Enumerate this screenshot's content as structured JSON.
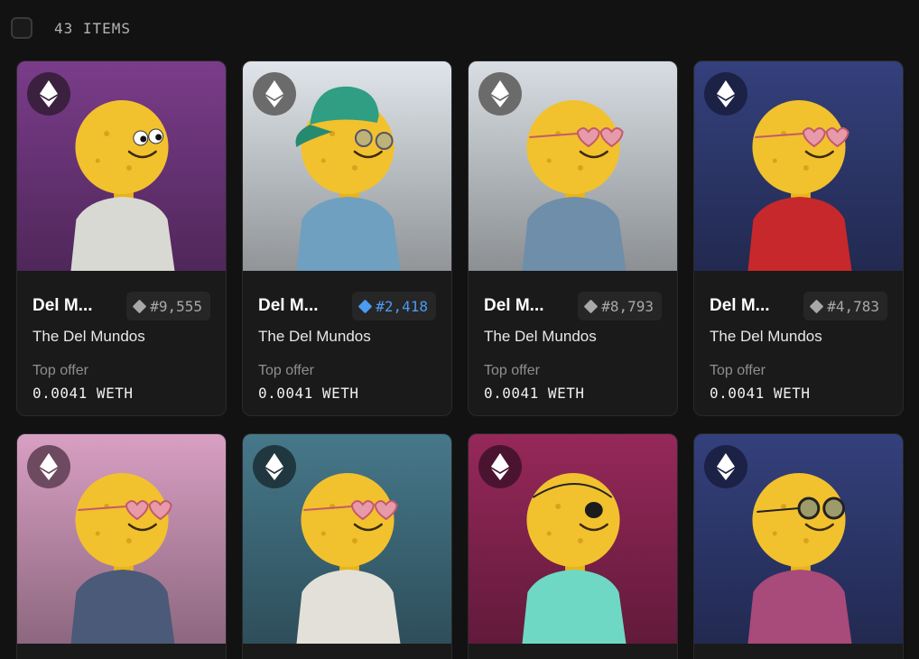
{
  "header": {
    "items_count": "43 ITEMS"
  },
  "cards": [
    {
      "name": "Del M...",
      "rank": "#9,555",
      "rank_color": "#a8a8a8",
      "collection": "The Del Mundos",
      "offer_label": "Top offer",
      "offer_value": "0.0041 WETH",
      "bg": "#7a3c8a",
      "badge_bg": "#3b2040",
      "shirt": "#d9d9d4",
      "accessory": "googly-eyes"
    },
    {
      "name": "Del M...",
      "rank": "#2,418",
      "rank_color": "#4b9bf2",
      "collection": "The Del Mundos",
      "offer_label": "Top offer",
      "offer_value": "0.0041 WETH",
      "bg": "#dfe5ea",
      "badge_bg": "#6b6b6b",
      "shirt": "#6fa0c0",
      "accessory": "cap-and-glasses"
    },
    {
      "name": "Del M...",
      "rank": "#8,793",
      "rank_color": "#a8a8a8",
      "collection": "The Del Mundos",
      "offer_label": "Top offer",
      "offer_value": "0.0041 WETH",
      "bg": "#d7dde2",
      "badge_bg": "#6b6b6b",
      "shirt": "#6e8eaa",
      "accessory": "heart-glasses"
    },
    {
      "name": "Del M...",
      "rank": "#4,783",
      "rank_color": "#a8a8a8",
      "collection": "The Del Mundos",
      "offer_label": "Top offer",
      "offer_value": "0.0041 WETH",
      "bg": "#34407c",
      "badge_bg": "#1c2146",
      "shirt": "#c7282b",
      "accessory": "heart-glasses"
    },
    {
      "name": "",
      "rank": "",
      "rank_color": "#a8a8a8",
      "collection": "",
      "offer_label": "",
      "offer_value": "",
      "bg": "#d89fc3",
      "badge_bg": "#6e4a60",
      "shirt": "#4a5a78",
      "accessory": "heart-glasses"
    },
    {
      "name": "",
      "rank": "",
      "rank_color": "#a8a8a8",
      "collection": "",
      "offer_label": "",
      "offer_value": "",
      "bg": "#46788a",
      "badge_bg": "#21373f",
      "shirt": "#e2e0d8",
      "accessory": "heart-glasses"
    },
    {
      "name": "",
      "rank": "",
      "rank_color": "#a8a8a8",
      "collection": "",
      "offer_label": "",
      "offer_value": "",
      "bg": "#96285a",
      "badge_bg": "#4a1430",
      "shirt": "#6ed8c4",
      "accessory": "eye-patch"
    },
    {
      "name": "",
      "rank": "",
      "rank_color": "#a8a8a8",
      "collection": "",
      "offer_label": "",
      "offer_value": "",
      "bg": "#34407c",
      "badge_bg": "#1c2146",
      "shirt": "#a84a7a",
      "accessory": "round-glasses"
    }
  ],
  "icons": {
    "chain": "ethereum-icon",
    "rank": "diamond-icon",
    "select": "checkbox"
  }
}
